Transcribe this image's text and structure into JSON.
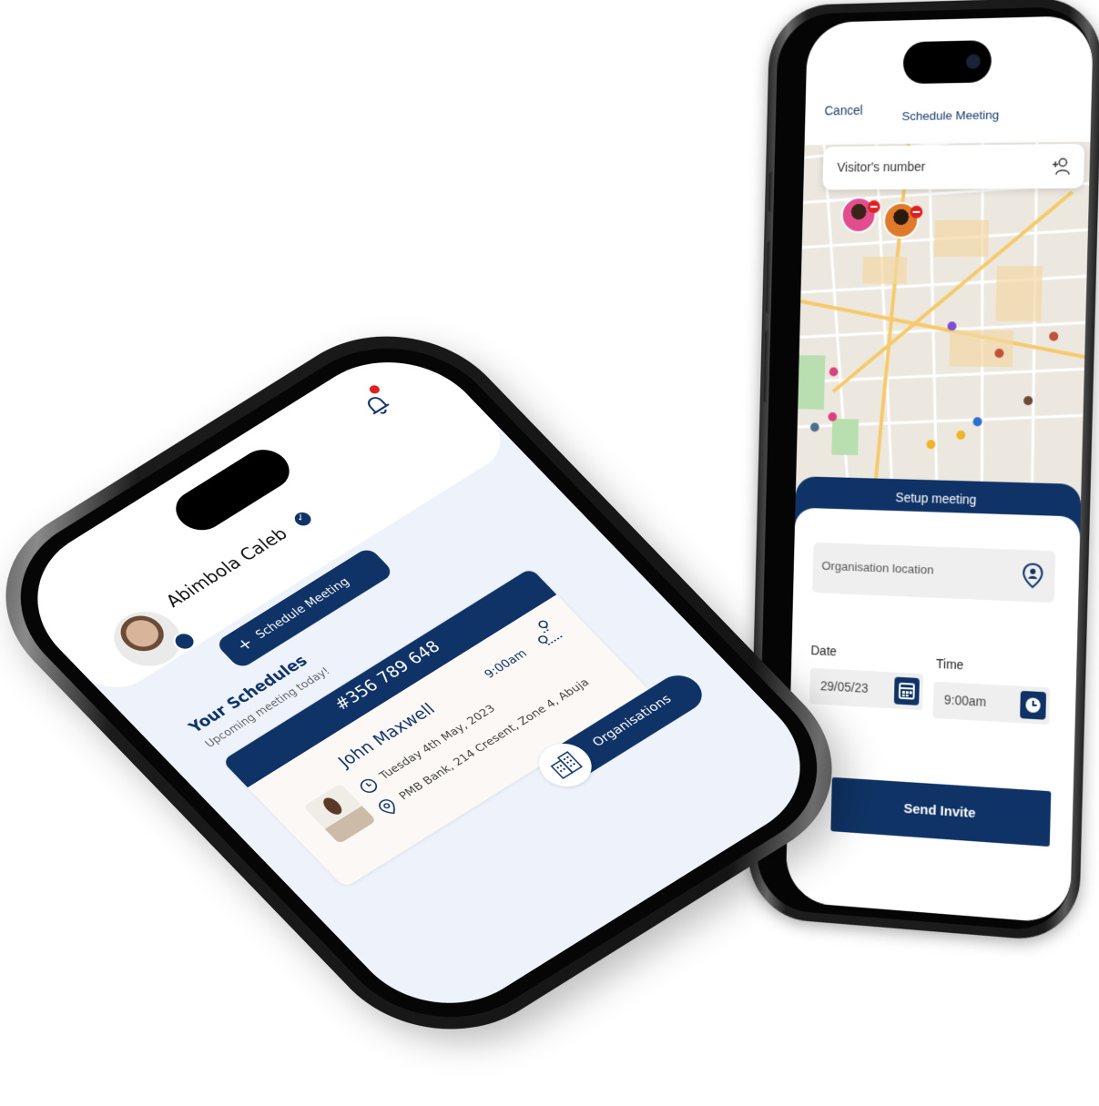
{
  "right_phone": {
    "topbar": {
      "cancel": "Cancel",
      "title": "Schedule Meeting"
    },
    "visitor_input": {
      "placeholder": "Visitor's number"
    },
    "setup": {
      "title": "Setup meeting",
      "org_location_placeholder": "Organisation location",
      "date_label": "Date",
      "date_value": "29/05/23",
      "time_label": "Time",
      "time_value": "9:00am",
      "send_label": "Send Invite"
    },
    "colors": {
      "primary": "#0f3366",
      "danger": "#e02020"
    }
  },
  "left_phone": {
    "user": {
      "name": "Abimbola Caleb"
    },
    "schedule_button": "Schedule Meeting",
    "section_title": "Your Schedules",
    "section_subtitle": "Upcoming meeting today!",
    "meeting": {
      "code": "#356 789 648",
      "guest": "John Maxwell",
      "time": "9:00am",
      "date": "Tuesday 4th May, 2023",
      "location": "PMB Bank, 214 Cresent, Zone 4, Abuja"
    },
    "organisations_button": "Organisations",
    "icons": [
      "bell-icon",
      "verified-icon",
      "plus-icon",
      "route-icon",
      "clock-icon",
      "location-icon",
      "building-icon"
    ]
  }
}
